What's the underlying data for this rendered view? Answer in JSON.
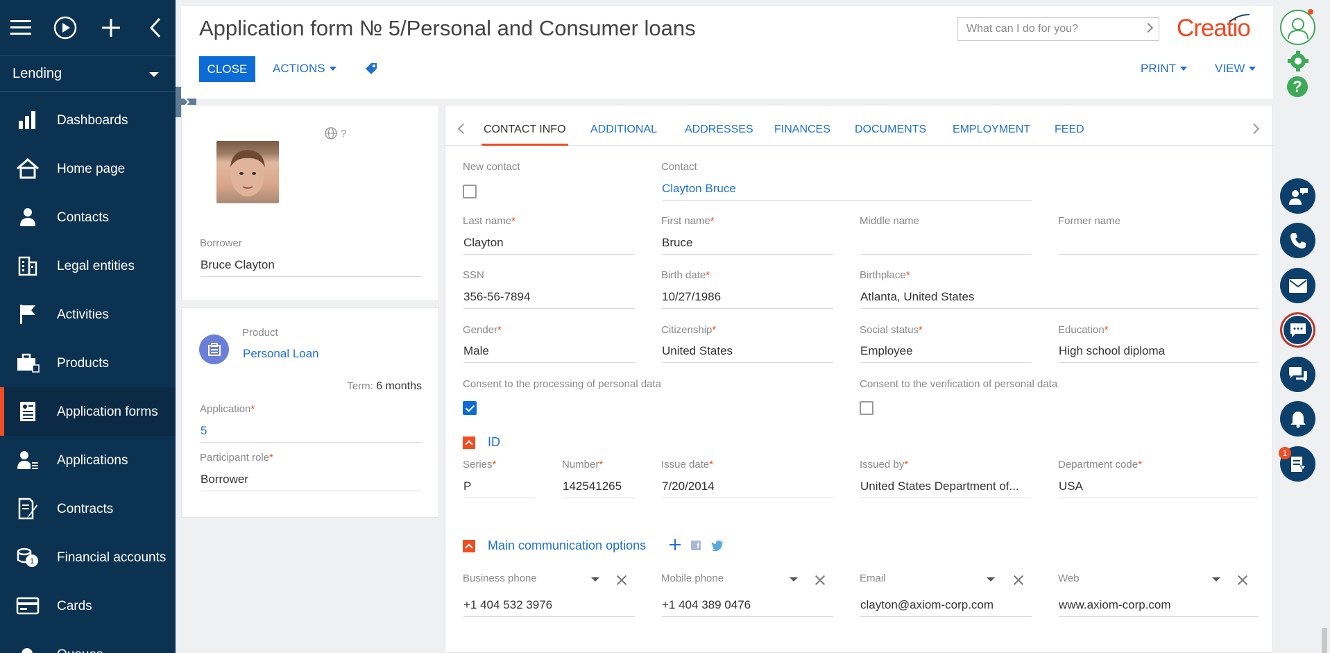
{
  "sidebar": {
    "workspace": "Lending",
    "items": [
      {
        "label": "Dashboards",
        "icon": "bar-chart-icon"
      },
      {
        "label": "Home page",
        "icon": "home-icon"
      },
      {
        "label": "Contacts",
        "icon": "person-icon"
      },
      {
        "label": "Legal entities",
        "icon": "building-icon"
      },
      {
        "label": "Activities",
        "icon": "flag-icon"
      },
      {
        "label": "Products",
        "icon": "briefcase-icon"
      },
      {
        "label": "Application forms",
        "icon": "form-icon",
        "active": true
      },
      {
        "label": "Applications",
        "icon": "person-list-icon"
      },
      {
        "label": "Contracts",
        "icon": "contract-pen-icon"
      },
      {
        "label": "Financial accounts",
        "icon": "coins-icon"
      },
      {
        "label": "Cards",
        "icon": "card-icon"
      },
      {
        "label": "Queues",
        "icon": "queue-icon"
      }
    ]
  },
  "header": {
    "title": "Application form № 5/Personal and Consumer loans",
    "close_label": "CLOSE",
    "actions_label": "ACTIONS",
    "print_label": "PRINT",
    "view_label": "VIEW",
    "search_placeholder": "What can I do for you?",
    "logo_text": "Creatio"
  },
  "rail": {
    "notification_count": "1"
  },
  "borrower_card": {
    "language_hint": "?",
    "borrower_label": "Borrower",
    "borrower_value": "Bruce Clayton"
  },
  "product_card": {
    "product_label": "Product",
    "product_value": "Personal Loan",
    "term_label": "Term:",
    "term_value": "6 months",
    "application_label": "Application",
    "application_value": "5",
    "role_label": "Participant role",
    "role_value": "Borrower"
  },
  "tabs": [
    "CONTACT INFO",
    "ADDITIONAL",
    "ADDRESSES",
    "FINANCES",
    "DOCUMENTS",
    "EMPLOYMENT",
    "FEED"
  ],
  "contact": {
    "new_contact_label": "New contact",
    "contact_label": "Contact",
    "contact_value": "Clayton Bruce",
    "last_name_label": "Last name",
    "last_name": "Clayton",
    "first_name_label": "First name",
    "first_name": "Bruce",
    "middle_name_label": "Middle name",
    "middle_name": "",
    "former_name_label": "Former name",
    "former_name": "",
    "ssn_label": "SSN",
    "ssn": "356-56-7894",
    "birth_date_label": "Birth date",
    "birth_date": "10/27/1986",
    "birthplace_label": "Birthplace",
    "birthplace": "Atlanta, United States",
    "gender_label": "Gender",
    "gender": "Male",
    "citizenship_label": "Citizenship",
    "citizenship": "United States",
    "social_status_label": "Social status",
    "social_status": "Employee",
    "education_label": "Education",
    "education": "High school diploma",
    "consent_processing_label": "Consent to the processing of personal data",
    "consent_processing": true,
    "consent_verification_label": "Consent to the verification of personal data",
    "consent_verification": false
  },
  "id_section": {
    "title": "ID",
    "series_label": "Series",
    "series": "P",
    "number_label": "Number",
    "number": "142541265",
    "issue_date_label": "Issue date",
    "issue_date": "7/20/2014",
    "issued_by_label": "Issued by",
    "issued_by": "United States Department of...",
    "dept_code_label": "Department code",
    "dept_code": "USA"
  },
  "comm_section": {
    "title": "Main communication options",
    "business_phone_label": "Business phone",
    "business_phone": "+1 404 532 3976",
    "mobile_phone_label": "Mobile phone",
    "mobile_phone": "+1 404 389 0476",
    "email_label": "Email",
    "email": "clayton@axiom-corp.com",
    "web_label": "Web",
    "web": "www.axiom-corp.com"
  },
  "colors": {
    "sidebar_bg": "#0c3252",
    "accent": "#f04e23",
    "primary": "#0d6bd6",
    "link": "#1f6fd1"
  }
}
